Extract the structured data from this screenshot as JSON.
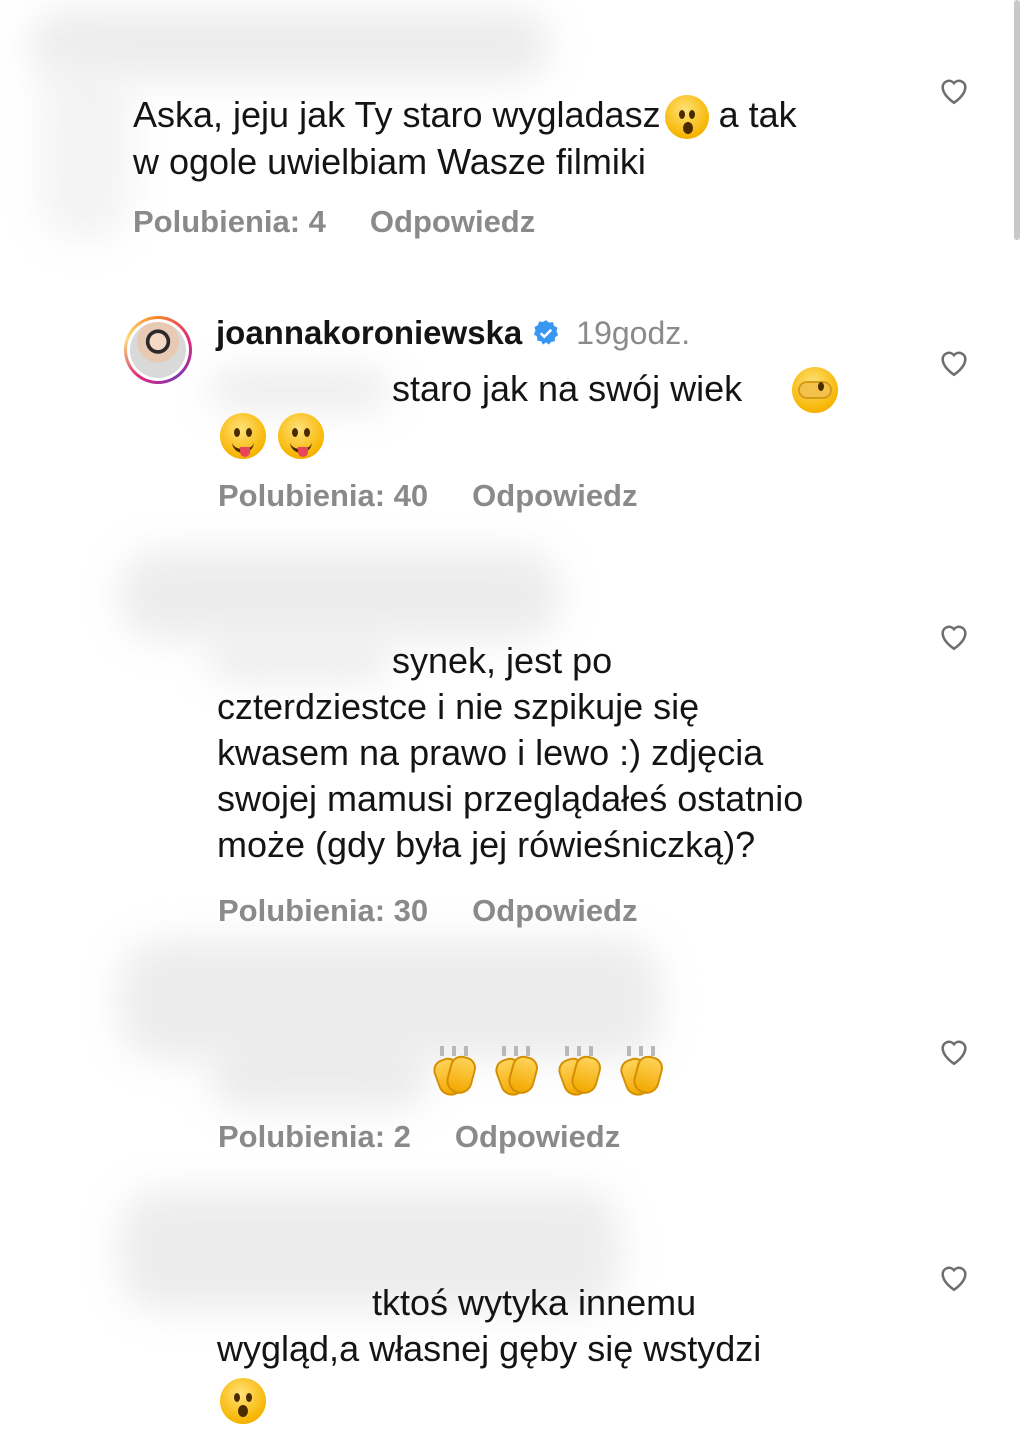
{
  "comments": [
    {
      "text": "Aska, jeju jak Ty staro wygladasz",
      "text_after_emoji": " a tak\nw ogole uwielbiam Wasze filmiki",
      "emoji": "astonished-face",
      "likes_label": "Polubienia: 4",
      "reply_label": "Odpowiedz"
    },
    {
      "username": "joannakoroniewska",
      "verified": true,
      "time": "19godz.",
      "text": "staro jak na swój wiek",
      "emojis": [
        "face-peeking",
        "zany-face",
        "winking-tongue-face"
      ],
      "likes_label": "Polubienia: 40",
      "reply_label": "Odpowiedz"
    },
    {
      "text": "synek, jest po\nczterdziestce i nie szpikuje się\nkwasem na prawo i lewo :) zdjęcia\nswojej mamusi przeglądałeś ostatnio\nmoże (gdy była jej rówieśniczką)?",
      "likes_label": "Polubienia: 30",
      "reply_label": "Odpowiedz"
    },
    {
      "emojis": [
        "clapping-hands",
        "clapping-hands",
        "clapping-hands",
        "clapping-hands"
      ],
      "likes_label": "Polubienia: 2",
      "reply_label": "Odpowiedz"
    },
    {
      "text": "tktoś wytyka innemu\nwygląd,a własnej gęby się wstydzi",
      "emoji": "astonished-face",
      "likes_label": "",
      "reply_label": ""
    }
  ],
  "colors": {
    "meta_gray": "#8a8a8a",
    "verified_blue": "#3897f0",
    "heart_stroke": "#6e6e6e"
  }
}
